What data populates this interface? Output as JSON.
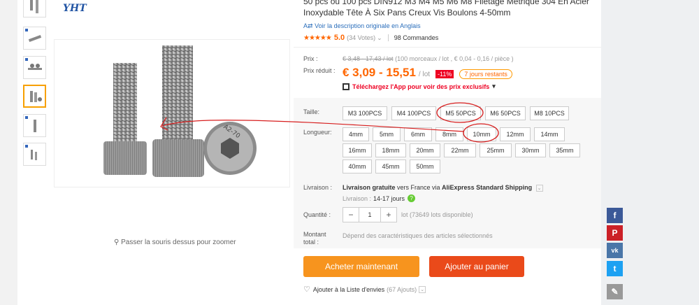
{
  "header": {
    "logo": "YHT",
    "title": "50 pcs ou 100 pcs DIN912 M3 M4 M5 M6 M8 Filetage Métrique 304 En Acier Inoxydable Tête À Six Pans Creux Vis Boulons 4-50mm"
  },
  "gallery": {
    "zoom_hint": "Passer la souris dessus pour zoomer",
    "image_marking": "A2-70"
  },
  "product": {
    "original_link": "Voir la description originale en Anglais",
    "stars": "★★★★★",
    "rating": "5.0",
    "votes": "(34 Votes)",
    "votes_caret": "⌄",
    "orders": "98 Commandes",
    "price_label": "Prix :",
    "old_price": "€ 3,48 - 17,43 / lot",
    "old_price_detail": "(100 morceaux / lot , € 0,04 - 0,16 / pièce )",
    "reduced_label": "Prix réduit :",
    "price": "€ 3,09 - 15,51",
    "price_unit": "/ lot",
    "discount": "-11%",
    "days_left": "7 jours restants",
    "app_promo": "Téléchargez l'App pour voir des prix exclusifs",
    "app_caret": "▾"
  },
  "options": {
    "size_label": "Taille:",
    "sizes": [
      "M3 100PCS",
      "M4 100PCS",
      "M5 50PCS",
      "M6 50PCS",
      "M8 10PCS"
    ],
    "length_label": "Longueur:",
    "lengths": [
      "4mm",
      "5mm",
      "6mm",
      "8mm",
      "10mm",
      "12mm",
      "14mm",
      "16mm",
      "18mm",
      "20mm",
      "22mm",
      "25mm",
      "30mm",
      "35mm",
      "40mm",
      "45mm",
      "50mm"
    ]
  },
  "shipping": {
    "label": "Livraison :",
    "main": "Livraison gratuite",
    "dest": " vers France via ",
    "method": "AliExpress Standard Shipping",
    "caret": "⌄",
    "days_label": "Livraison :",
    "days_value": "14-17 jours",
    "help": "?"
  },
  "quantity": {
    "label": "Quantité :",
    "minus": "−",
    "value": "1",
    "plus": "+",
    "available": "lot (73649 lots disponible)"
  },
  "total": {
    "label": "Montant total :",
    "note": "Dépend des caractéristiques des articles sélectionnés"
  },
  "actions": {
    "buy_now": "Acheter maintenant",
    "add_to_cart": "Ajouter au panier",
    "wishlist": "Ajouter à la Liste d'envies",
    "wish_heart": "♡",
    "wish_count": "(67 Ajouts)",
    "wish_caret": "⌄"
  },
  "social": {
    "facebook": "f",
    "pinterest": "P",
    "vk": "vk",
    "twitter": "t",
    "edit": "✎"
  },
  "colors": {
    "accent": "#f60",
    "buy": "#f7941e",
    "cart": "#ea4a1a",
    "annotation": "#d71e1e",
    "selected_thumb": "#f7a000"
  }
}
